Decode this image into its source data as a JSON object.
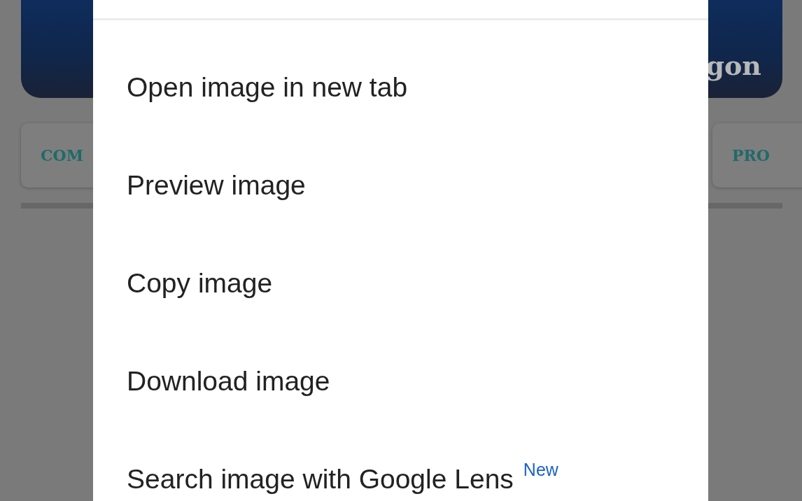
{
  "page": {
    "banner": {
      "text": "gon"
    },
    "cards": [
      {
        "label": "COM"
      },
      {
        "label": "PRO"
      }
    ]
  },
  "context_menu": {
    "items": [
      {
        "label": "Open image in new tab"
      },
      {
        "label": "Preview image"
      },
      {
        "label": "Copy image"
      },
      {
        "label": "Download image"
      },
      {
        "label": "Search image with Google Lens",
        "badge": "New"
      }
    ]
  }
}
